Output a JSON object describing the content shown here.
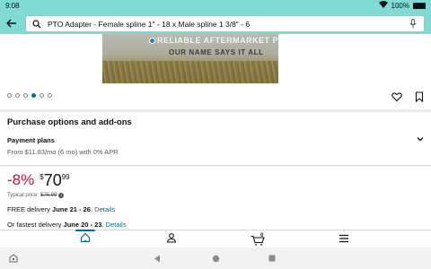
{
  "status_bar": {
    "time": "9:08",
    "battery_percent": "100%"
  },
  "search": {
    "query": "PTO Adapter - Female spline 1\" - 18 x Male spline 1 3/8\" - 6"
  },
  "product_image": {
    "brand_name": "RELIABLE AFTERMARKET PARTS",
    "tagline": "OUR NAME SAYS IT ALL"
  },
  "carousel": {
    "total": 6,
    "active_index": 3
  },
  "purchase_options": {
    "title": "Purchase options and add-ons",
    "payment_label": "Payment plans",
    "payment_detail": "From $11.83/mo (6 mo) with 0% APR"
  },
  "price": {
    "discount": "-8%",
    "symbol": "$",
    "whole": "70",
    "fraction": "99",
    "typical_label": "Typical price:",
    "typical_value": "$76.99"
  },
  "delivery": {
    "free_prefix": "FREE delivery",
    "free_dates": "June 21 - 26",
    "free_suffix": ".",
    "free_link": "Details",
    "fast_prefix": "Or fastest delivery",
    "fast_dates": "June 20 - 23",
    "fast_suffix": ".",
    "fast_link": "Details"
  },
  "bottom_nav": {
    "items": [
      "home-icon",
      "account-icon",
      "cart-icon",
      "menu-icon"
    ],
    "cart_count": "0"
  },
  "colors": {
    "header": "#7fdbd3",
    "accent": "#007185",
    "discount": "#cc0c39"
  }
}
